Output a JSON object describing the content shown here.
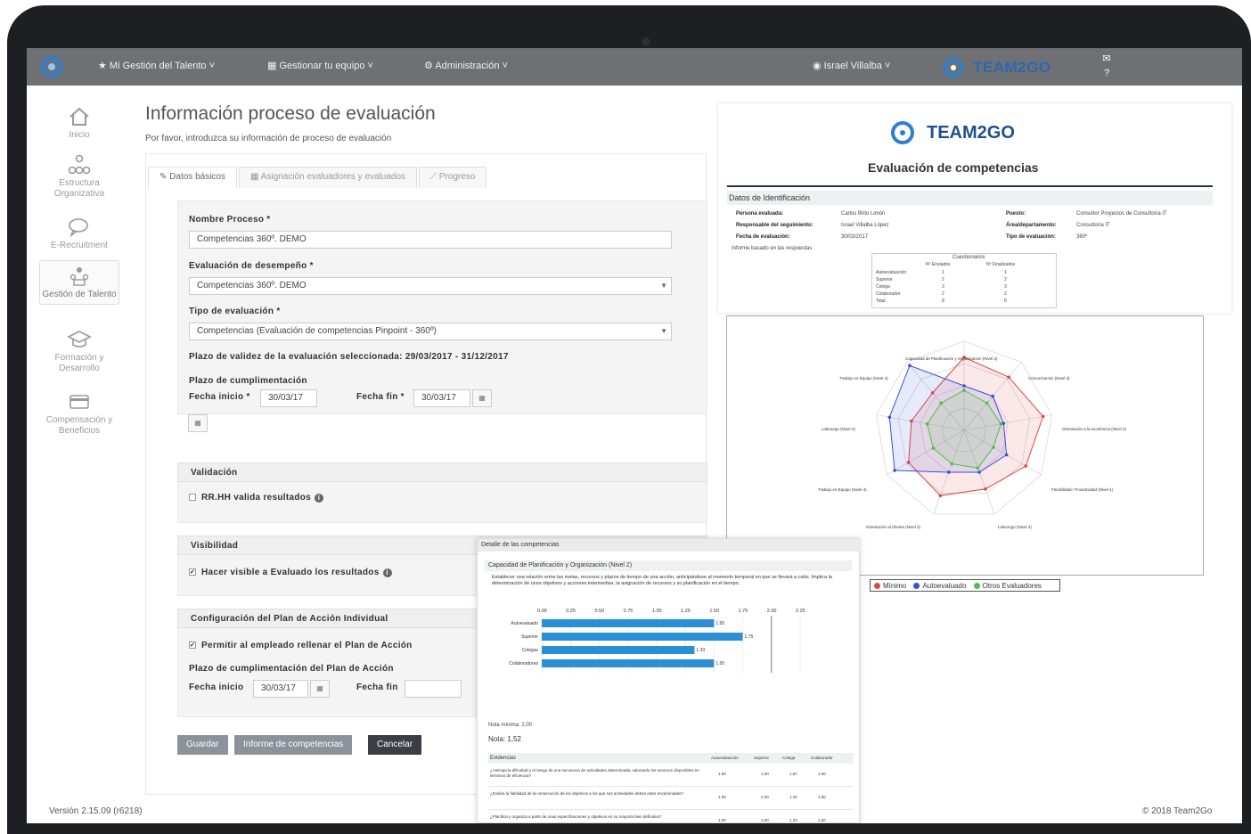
{
  "topbar": {
    "nav1": "★ Mi Gestión del Talento ˅",
    "nav2": "Gestionar tu equipo ˅",
    "nav3": "Administración ˅",
    "user": "Israel Villalba ˅",
    "brand": "TEAM2GO"
  },
  "sidebar": {
    "items": [
      {
        "label": "Inicio"
      },
      {
        "label": "Estructura Organizativa"
      },
      {
        "label": "E-Recruitment"
      },
      {
        "label": "Gestión de Talento"
      },
      {
        "label": "Formación y Desarrollo"
      },
      {
        "label": "Compensación y Beneficios"
      }
    ]
  },
  "page": {
    "title": "Información proceso de evaluación",
    "subtitle": "Por favor, introduzca su información de proceso de evaluación"
  },
  "tabs": [
    {
      "label": "Datos básicos"
    },
    {
      "label": "Asignación evaluadores y evaluados"
    },
    {
      "label": "Progreso"
    }
  ],
  "form": {
    "nombre_label": "Nombre Proceso *",
    "nombre_value": "Competencias 360º. DEMO",
    "evaluacion_label": "Evaluación de desempeño *",
    "evaluacion_value": "Competencias 360º. DEMO",
    "tipo_label": "Tipo de evaluación *",
    "tipo_value": "Competencias (Evaluación de competencias Pinpoint - 360º)",
    "plazo_validez": "Plazo de validez de la evaluación seleccionada: 29/03/2017 - 31/12/2017",
    "plazo_cumplimentacion": "Plazo de cumplimentación",
    "fecha_inicio_label": "Fecha inicio *",
    "fecha_inicio_value": "30/03/17",
    "fecha_fin_label": "Fecha fin *",
    "fecha_fin_value": "30/03/17",
    "validacion_title": "Validación",
    "validacion_chk": "RR.HH valida resultados",
    "visibilidad_title": "Visibilidad",
    "visibilidad_chk": "Hacer visible a Evaluado los resultados",
    "config_title": "Configuración del Plan de Acción Individual",
    "config_chk": "Permitir al empleado rellenar el Plan de Acción",
    "plazo_plan": "Plazo de cumplimentación del Plan de Acción",
    "plan_inicio_label": "Fecha inicio",
    "plan_inicio_value": "30/03/17",
    "plan_fin_label": "Fecha fin",
    "plan_fin_value": ""
  },
  "buttons": {
    "guardar": "Guardar",
    "informe": "Informe de competencias",
    "cancelar": "Cancelar"
  },
  "report": {
    "brand": "TEAM2GO",
    "title": "Evaluación de competencias",
    "ident_title": "Datos de Identificación",
    "rows": [
      {
        "k": "Persona evaluada:",
        "v": "Carlos Brito Limón",
        "k2": "Puesto:",
        "v2": "Consultor Proyectos de Consultoría IT"
      },
      {
        "k": "Responsable del seguimiento:",
        "v": "Israel Villalba López",
        "k2": "Área/departamento:",
        "v2": "Consultoría IT"
      },
      {
        "k": "Fecha de evaluación:",
        "v": "30/03/2017",
        "k2": "Tipo de evaluación:",
        "v2": "360º"
      }
    ],
    "informe_note": "Informe basado en las respuestas",
    "table_head": "Cuestionarios",
    "table_cols": [
      "Nº Enviados",
      "Nº Finalizados"
    ],
    "table_rows": [
      [
        "Autoevaluación",
        "1",
        "1"
      ],
      [
        "Superior",
        "2",
        "2"
      ],
      [
        "Colega",
        "3",
        "3"
      ],
      [
        "Colaborador",
        "2",
        "2"
      ],
      [
        "Total",
        "8",
        "8"
      ]
    ]
  },
  "radar": {
    "axes": [
      "Capacidad de Planificación y Organización (Nivel 2)",
      "Comunicación (Nivel 3)",
      "Orientación a la excelencia (Nivel 2)",
      "Flexibilidad / Proactividad (Nivel 4)",
      "Liderazgo (Nivel 3)",
      "Orientación al Cliente (Nivel 3)",
      "Trabajo en Equipo (Nivel 4)",
      "Liderazgo (Nivel 3)",
      "Trabajo en Equipo (Nivel 4)"
    ],
    "legend": [
      "Mínimo",
      "Autoevaluado",
      "Otros Evaluadores"
    ],
    "colors": {
      "minimo": "#e04545",
      "auto": "#3a4fd8",
      "otros": "#4bbf4b"
    }
  },
  "detail": {
    "header": "Detalle de las competencias",
    "competency": "Capacidad de Planificación y Organización (Nivel 2)",
    "description": "Establecer una relación entre las metas, recursos y plazos de tiempo de una acción, anticipándose al momento temporal en que se llevará a cabo. Implica la determinación de unos objetivos y acciones intermedias, la asignación de recursos y su planificación en el tiempo.",
    "axis_ticks": [
      "0.00",
      "0.25",
      "0.50",
      "0.75",
      "1.00",
      "1.25",
      "1.50",
      "1.75",
      "2.00",
      "2.25"
    ],
    "nota_minima": "Nota mínima: 2,00",
    "nota": "Nota: 1,52",
    "evid_head": [
      "Evidencias",
      "Autoevaluación",
      "Superior",
      "Colega",
      "Colaborador"
    ],
    "evid_rows": [
      [
        "¿Anticipa la dificultad y el riesgo de una secuencia de actividades determinada, valorando los recursos disponibles en términos de eficiencia?",
        "1.00",
        "1.00",
        "1.67",
        "1.50"
      ],
      [
        "¿Evalúa la fiabilidad de la consecución de los objetivos a los que sus actividades deben estar encaminadas?",
        "1.00",
        "2.00",
        "1.33",
        "1.50"
      ],
      [
        "¿Planifica y organiza a partir de unas especificaciones y objetivos en su mayoría bien definidos?",
        "1.00",
        "1.00",
        "1.33",
        "1.50"
      ],
      [
        "¿Asigna tareas rutinarias de planificación a colaboradores que afecten a grupos pequeños de personas?",
        "1.00",
        "2.00",
        "1.00",
        "1.50"
      ]
    ]
  },
  "chart_data": {
    "type": "bar",
    "categories": [
      "Autoevaluado",
      "Superior",
      "Colegas",
      "Colaboradores"
    ],
    "values": [
      1.5,
      1.75,
      1.33,
      1.5
    ],
    "xlim": [
      0,
      2.25
    ]
  },
  "footer": {
    "version": "Versión 2.15.09 (r6218)",
    "copyright": "© 2018 Team2Go"
  }
}
